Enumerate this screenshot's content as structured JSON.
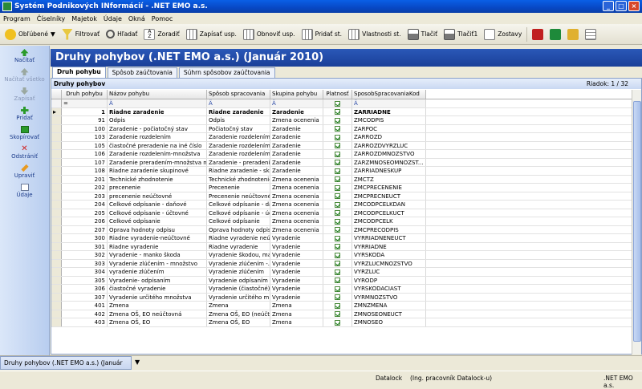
{
  "window": {
    "title": "Systém Podnikových INformácií - .NET EMO a.s."
  },
  "menu": [
    "Program",
    "Číselníky",
    "Majetok",
    "Údaje",
    "Okná",
    "Pomoc"
  ],
  "toolbar": [
    "Obľúbené",
    "Filtrovať",
    "Hľadať",
    "Zoradiť",
    "Zapísať usp.",
    "Obnoviť usp.",
    "Pridať st.",
    "Vlastnosti st.",
    "Tlačiť",
    "Tlačiť1",
    "Zostavy"
  ],
  "sidebar": [
    {
      "label": "Načítať",
      "enabled": true
    },
    {
      "label": "Načítať všetko",
      "enabled": false
    },
    {
      "label": "Zapísať",
      "enabled": false
    },
    {
      "label": "Pridať",
      "enabled": true
    },
    {
      "label": "Skopírovať",
      "enabled": true
    },
    {
      "label": "Odstrániť",
      "enabled": true
    },
    {
      "label": "Upraviť",
      "enabled": true
    },
    {
      "label": "Údaje",
      "enabled": true
    }
  ],
  "page": {
    "title": "Druhy pohybov (.NET EMO a.s.) (Január 2010)"
  },
  "tabs": [
    "Druh pohybu",
    "Spôsob zaúčtovania",
    "Súhrn spôsobov zaúčtovania"
  ],
  "panel": {
    "title": "Druhy pohybov",
    "row_counter": "Riadok: 1 / 32"
  },
  "grid": {
    "columns": [
      "Druh pohybu",
      "Názov pohybu",
      "Spôsob spracovania",
      "Skupina pohybu",
      "Platnosť",
      "SposobSpracovaniaKod"
    ],
    "filter_icon": "Ä",
    "filter_op": "=",
    "rows": [
      [
        "1",
        "Riadne zaradenie",
        "Riadne zaradenie",
        "Zaradenie",
        "ZARRIADNE"
      ],
      [
        "91",
        "Odpis",
        "Odpis",
        "Zmena ocenenia",
        "ZMCODPIS"
      ],
      [
        "100",
        "Zaradenie - počiatočný stav",
        "Počiatočný stav",
        "Zaradenie",
        "ZARPOC"
      ],
      [
        "103",
        "Zaradenie rozdelením",
        "Zaradenie rozdelením",
        "Zaradenie",
        "ZARROZD"
      ],
      [
        "105",
        "čiastočné preradenie na iné číslo",
        "Zaradenie rozdelením",
        "Zaradenie",
        "ZARROZDVYRZLUC"
      ],
      [
        "106",
        "Zaradenie rozdelením-množstva",
        "Zaradenie rozdelením",
        "Zaradenie",
        "ZARROZDMNOZSTVO"
      ],
      [
        "107",
        "Zaradenie preradením-množstva na i...",
        "Zaradenie - preradení...",
        "Zaradenie",
        "ZARZMNOSEOMNOZST..."
      ],
      [
        "108",
        "Riadne zaradenie skupinové",
        "Riadne zaradenie - sk...",
        "Zaradenie",
        "ZARRIADNESKUP"
      ],
      [
        "201",
        "Technické zhodnotenie",
        "Technické zhodnotenie",
        "Zmena ocenenia",
        "ZMCTZ"
      ],
      [
        "202",
        "precenenie",
        "Precenenie",
        "Zmena ocenenia",
        "ZMCPRECENENIE"
      ],
      [
        "203",
        "precenenie neúčtovné",
        "Precenenie neúčtovné",
        "Zmena ocenenia",
        "ZMCPRECNEUCT"
      ],
      [
        "204",
        "Celkové odpísanie - daňové",
        "Celkové odpísanie - da...",
        "Zmena ocenenia",
        "ZMCODPCELKDAN"
      ],
      [
        "205",
        "Celkové odpísanie - účtovné",
        "Celkové odpísanie - úč...",
        "Zmena ocenenia",
        "ZMCODPCELKUCT"
      ],
      [
        "206",
        "Celkové odpísanie",
        "Celkové odpísanie",
        "Zmena ocenenia",
        "ZMCODPCELK"
      ],
      [
        "207",
        "Oprava hodnoty odpisu",
        "Oprava hodnoty odpisu",
        "Zmena ocenenia",
        "ZMCPRECODPIS"
      ],
      [
        "300",
        "Riadne vyradenie-neúčtovné",
        "Riadne vyradenie neú...",
        "Vyradenie",
        "VYRRIADNENEUCT"
      ],
      [
        "301",
        "Riadne vyradenie",
        "Riadne vyradenie",
        "Vyradenie",
        "VYRRIADNE"
      ],
      [
        "302",
        "Vyradenie - manko škoda",
        "Vyradenie škodou, ma...",
        "Vyradenie",
        "VYRSKODA"
      ],
      [
        "303",
        "Vyradenie zlúčením - množstvo",
        "Vyradenie zlúčením -...",
        "Vyradenie",
        "VYRZLUCMNOZSTVO"
      ],
      [
        "304",
        "vyradenie zlúčením",
        "Vyradenie zlúčením",
        "Vyradenie",
        "VYRZLUC"
      ],
      [
        "305",
        "Vyradenie- odpísaním",
        "Vyradenie odpísaním",
        "Vyradenie",
        "VYRODP"
      ],
      [
        "306",
        "čiastočné vyradenie",
        "Vyradenie (čiastočné)...",
        "Vyradenie",
        "VYRSKODACIAST"
      ],
      [
        "307",
        "Vyradenie určitého množstva",
        "Vyradenie určitého mn...",
        "Vyradenie",
        "VYRMNOZSTVO"
      ],
      [
        "401",
        "Zmena",
        "Zmena",
        "Zmena",
        "ZMNZMENA"
      ],
      [
        "402",
        "Zmena OŠ, EO neúčtovná",
        "Zmena OŠ, EO (neúčt...",
        "Zmena",
        "ZMNOSEONEUCT"
      ],
      [
        "403",
        "Zmena OŠ, EO",
        "Zmena OŠ, EO",
        "Zmena",
        "ZMNOSEO"
      ]
    ]
  },
  "taskbar": {
    "tab": "Druhy pohybov (.NET EMO a.s.) (Január 2010)"
  },
  "status": {
    "db": "Datalock",
    "user": "(Ing. pracovník Datalock-u)",
    "company": ".NET EMO a.s."
  }
}
